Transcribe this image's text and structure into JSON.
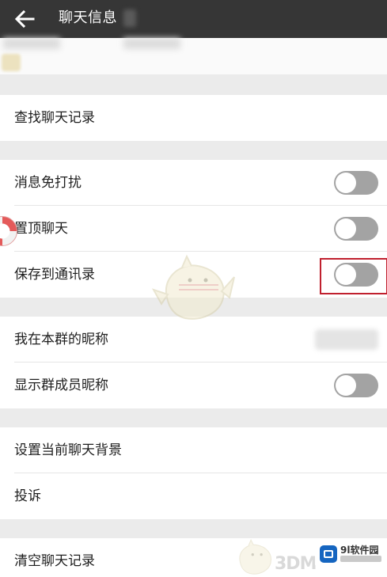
{
  "header": {
    "title": "聊天信息",
    "back_icon": "arrow-left-icon"
  },
  "sections": [
    {
      "items": [
        {
          "label": "查找聊天记录"
        }
      ]
    },
    {
      "items": [
        {
          "label": "消息免打扰",
          "toggle": false
        },
        {
          "label": "置顶聊天",
          "toggle": false
        },
        {
          "label": "保存到通讯录",
          "toggle": false,
          "highlighted": true
        }
      ]
    },
    {
      "items": [
        {
          "label": "我在本群的昵称"
        },
        {
          "label": "显示群成员昵称",
          "toggle": false
        }
      ]
    },
    {
      "items": [
        {
          "label": "设置当前聊天背景"
        },
        {
          "label": "投诉"
        }
      ]
    },
    {
      "items": [
        {
          "label": "清空聊天记录"
        }
      ]
    }
  ],
  "watermarks": {
    "site_badge": "9l软件园",
    "mark_3dm": "3DM"
  },
  "colors": {
    "header_bg": "#363636",
    "page_bg": "#ebebeb",
    "toggle_off": "#a3a3a3",
    "highlight_border": "#c0202e"
  }
}
